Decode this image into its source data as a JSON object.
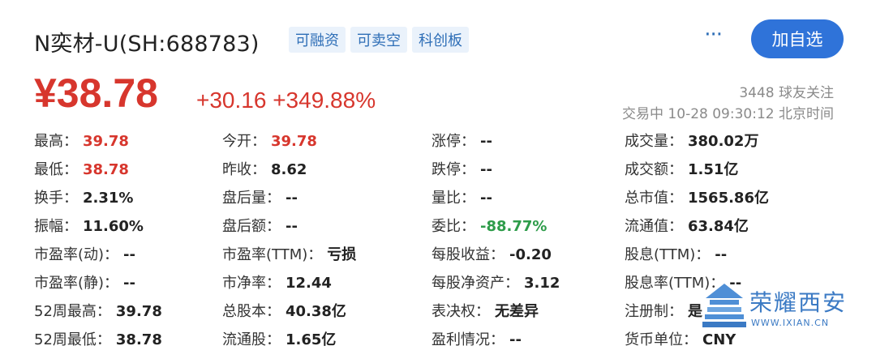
{
  "header": {
    "stock_name": "N奕材-U(SH:688783)",
    "tags": [
      "可融资",
      "可卖空",
      "科创板"
    ],
    "more_label": "···",
    "add_button_label": "加自选"
  },
  "price": {
    "current": "¥38.78",
    "change": "+30.16 +349.88%",
    "followers": "3448 球友关注",
    "trade_time": "交易中 10-28 09:30:12 北京时间"
  },
  "stats": [
    [
      [
        "最高：",
        "39.78",
        "red"
      ],
      [
        "今开：",
        "39.78",
        "red"
      ],
      [
        "涨停：",
        "--",
        ""
      ],
      [
        "成交量：",
        "380.02万",
        ""
      ]
    ],
    [
      [
        "最低：",
        "38.78",
        "red"
      ],
      [
        "昨收：",
        "8.62",
        ""
      ],
      [
        "跌停：",
        "--",
        ""
      ],
      [
        "成交额：",
        "1.51亿",
        ""
      ]
    ],
    [
      [
        "换手：",
        "2.31%",
        ""
      ],
      [
        "盘后量：",
        "--",
        ""
      ],
      [
        "量比：",
        "--",
        ""
      ],
      [
        "总市值：",
        "1565.86亿",
        ""
      ]
    ],
    [
      [
        "振幅：",
        "11.60%",
        ""
      ],
      [
        "盘后额：",
        "--",
        ""
      ],
      [
        "委比：",
        "-88.77%",
        "green"
      ],
      [
        "流通值：",
        "63.84亿",
        ""
      ]
    ],
    [
      [
        "市盈率(动)：",
        "--",
        ""
      ],
      [
        "市盈率(TTM)：",
        "亏损",
        ""
      ],
      [
        "每股收益：",
        "-0.20",
        ""
      ],
      [
        "股息(TTM)：",
        "--",
        ""
      ]
    ],
    [
      [
        "市盈率(静)：",
        "--",
        ""
      ],
      [
        "市净率：",
        "12.44",
        ""
      ],
      [
        "每股净资产：",
        "3.12",
        ""
      ],
      [
        "股息率(TTM)：",
        "--",
        ""
      ]
    ],
    [
      [
        "52周最高：",
        "39.78",
        ""
      ],
      [
        "总股本：",
        "40.38亿",
        ""
      ],
      [
        "表决权：",
        "无差异",
        ""
      ],
      [
        "注册制：",
        "是",
        ""
      ]
    ],
    [
      [
        "52周最低：",
        "38.78",
        ""
      ],
      [
        "流通股：",
        "1.65亿",
        ""
      ],
      [
        "盈利情况：",
        "--",
        ""
      ],
      [
        "货币单位：",
        "CNY",
        ""
      ]
    ]
  ],
  "watermark": {
    "text": "荣耀西安",
    "url": "WWW.IXIAN.CN"
  },
  "colors": {
    "up": "#d7362d",
    "down": "#2e9c4a",
    "accent": "#2f73d9"
  }
}
